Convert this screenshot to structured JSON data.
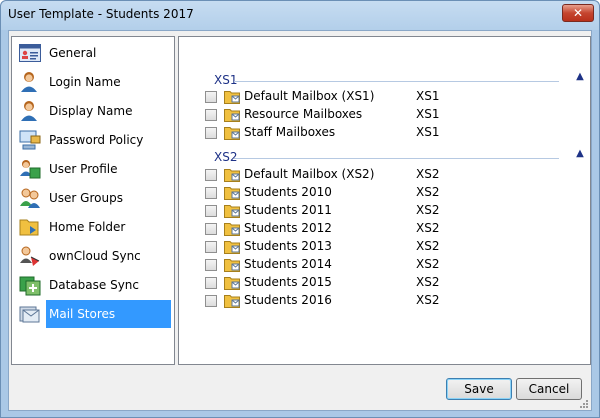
{
  "window": {
    "title": "User Template - Students 2017",
    "close_label": "✕"
  },
  "nav": {
    "selected_index": 9,
    "items": [
      {
        "label": "General",
        "icon": "general-card-icon"
      },
      {
        "label": "Login Name",
        "icon": "user-login-icon"
      },
      {
        "label": "Display Name",
        "icon": "user-display-icon"
      },
      {
        "label": "Password Policy",
        "icon": "password-policy-icon"
      },
      {
        "label": "User Profile",
        "icon": "user-profile-icon"
      },
      {
        "label": "User Groups",
        "icon": "user-groups-icon"
      },
      {
        "label": "Home Folder",
        "icon": "home-folder-icon"
      },
      {
        "label": "ownCloud Sync",
        "icon": "owncloud-sync-icon"
      },
      {
        "label": "Database Sync",
        "icon": "database-sync-icon"
      },
      {
        "label": "Mail Stores",
        "icon": "mail-stores-icon"
      }
    ]
  },
  "groups": [
    {
      "title": "XS1",
      "collapse_icon": "chevron-up-icon",
      "items": [
        {
          "name": "Default Mailbox (XS1)",
          "server": "XS1",
          "checked": false
        },
        {
          "name": "Resource Mailboxes",
          "server": "XS1",
          "checked": false
        },
        {
          "name": "Staff Mailboxes",
          "server": "XS1",
          "checked": false
        }
      ]
    },
    {
      "title": "XS2",
      "collapse_icon": "chevron-up-icon",
      "items": [
        {
          "name": "Default Mailbox (XS2)",
          "server": "XS2",
          "checked": false
        },
        {
          "name": "Students 2010",
          "server": "XS2",
          "checked": false
        },
        {
          "name": "Students 2011",
          "server": "XS2",
          "checked": false
        },
        {
          "name": "Students 2012",
          "server": "XS2",
          "checked": false
        },
        {
          "name": "Students 2013",
          "server": "XS2",
          "checked": false
        },
        {
          "name": "Students 2014",
          "server": "XS2",
          "checked": false
        },
        {
          "name": "Students 2015",
          "server": "XS2",
          "checked": false
        },
        {
          "name": "Students 2016",
          "server": "XS2",
          "checked": false
        }
      ]
    }
  ],
  "footer": {
    "save_label": "Save",
    "cancel_label": "Cancel"
  },
  "colors": {
    "selection": "#3399ff",
    "group_title": "#1e3287",
    "folder": "#f0c040"
  }
}
